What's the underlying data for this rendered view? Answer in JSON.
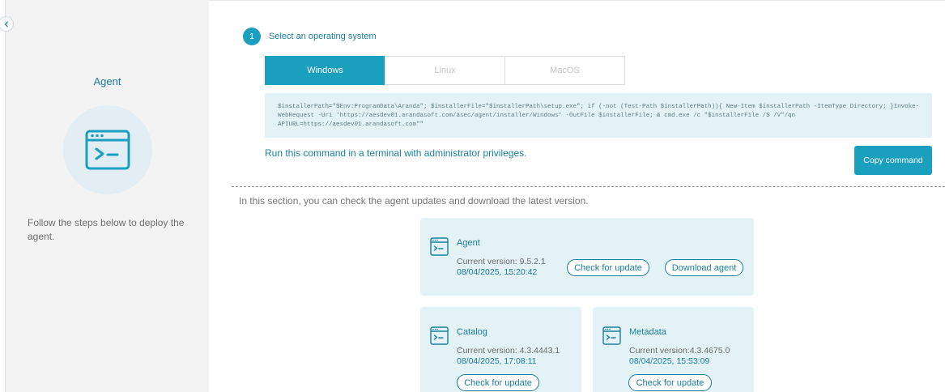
{
  "left_panel": {
    "title": "Agent",
    "icon": "terminal-window-icon",
    "description": "Follow the steps below to deploy the agent."
  },
  "collapse_icon": "chevron-left-icon",
  "step": {
    "number": "1",
    "label": "Select an operating system"
  },
  "os_tabs": [
    {
      "label": "Windows",
      "active": true
    },
    {
      "label": "Linux",
      "active": false
    },
    {
      "label": "MacOS",
      "active": false
    }
  ],
  "command": {
    "text": "$installerPath=\"$Env:ProgramData\\Aranda\"; $installerFile=\"$installerPath\\setup.exe\"; if (-not (Test-Path $installerPath)){ New-Item $installerPath -ItemType Directory; }Invoke-WebRequest -Uri 'https://aesdev01.arandasoft.com/asec/agent/installer/Windows' -OutFile $installerFile; & cmd.exe /c \"$installerFile /S /V\"/qn APIURL=https://aesdev01.arandasoft.com\"\"",
    "note": "Run this command in a terminal with administrator privileges.",
    "copy_label": "Copy command"
  },
  "updates": {
    "intro": "In this section, you can check the agent updates and download the latest version.",
    "cards": [
      {
        "title": "Agent",
        "version": "Current version: 9.5.2.1",
        "date": "08/04/2025, 15:20:42",
        "check_label": "Check for update",
        "download_label": "Download agent"
      },
      {
        "title": "Catalog",
        "version": "Current version: 4.3.4443.1",
        "date": "08/04/2025, 17:08:11",
        "check_label": "Check for update"
      },
      {
        "title": "Metadata",
        "version": "Current version:4.3.4675.0",
        "date": "08/04/2025, 15:53:09",
        "check_label": "Check for update"
      }
    ]
  },
  "colors": {
    "accent": "#1a9fbf",
    "accent_text": "#1b7f9c",
    "card_bg": "#e3f2f6",
    "sidebar_bg": "#f3f3f3"
  }
}
